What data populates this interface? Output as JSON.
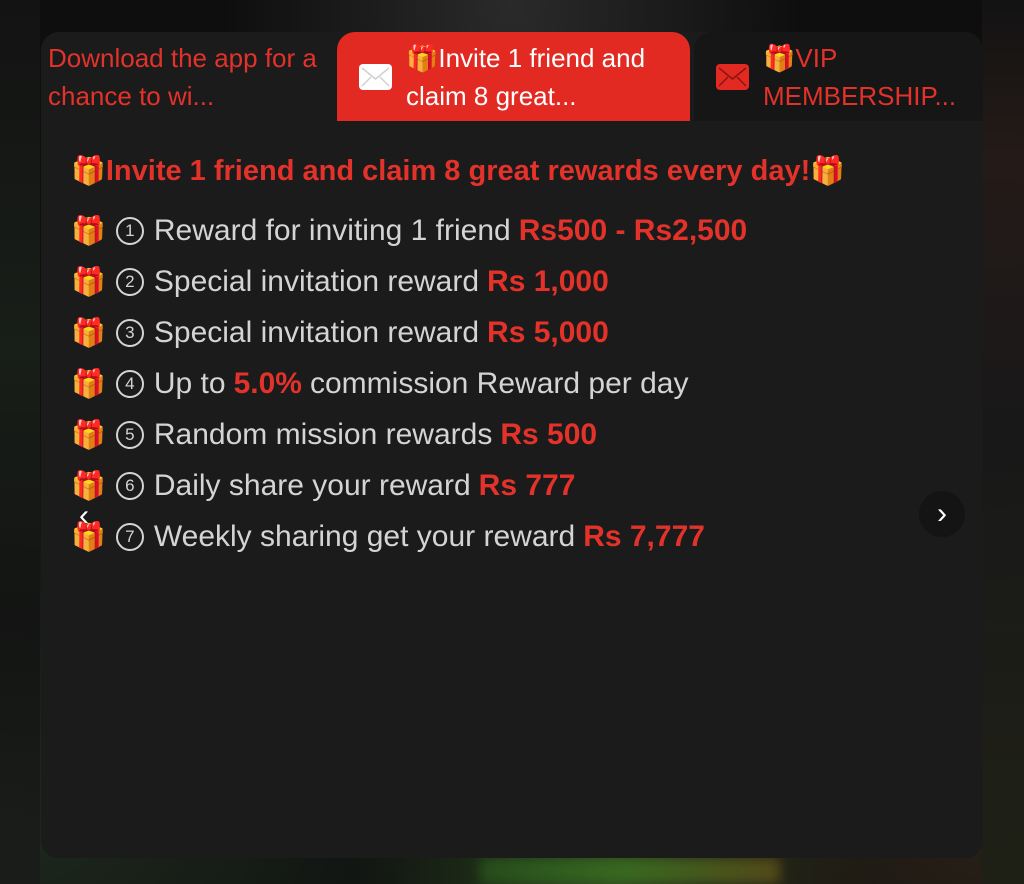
{
  "tabs": [
    {
      "label": "Download the app for a chance to wi...",
      "active": false,
      "icon": "none"
    },
    {
      "label": "🎁Invite 1 friend and claim 8 great...",
      "active": true,
      "icon": "mail-icon"
    },
    {
      "label": "🎁VIP MEMBERSHIP...",
      "active": false,
      "icon": "mail-icon"
    }
  ],
  "headline": {
    "gift_left": "🎁",
    "text": "Invite 1 friend and claim 8 great rewards every day!",
    "gift_right": "🎁"
  },
  "rewards": [
    {
      "gift": "🎁",
      "num": "1",
      "text": "Reward for inviting 1 friend",
      "amount": "Rs500 - Rs2,500"
    },
    {
      "gift": "🎁",
      "num": "2",
      "text": "Special invitation reward",
      "amount": "Rs 1,000"
    },
    {
      "gift": "🎁",
      "num": "3",
      "text": "Special invitation reward",
      "amount": "Rs 5,000"
    },
    {
      "gift": "🎁",
      "num": "4",
      "text_before": "Up to",
      "amount": "5.0%",
      "text_after": "commission Reward per day"
    },
    {
      "gift": "🎁",
      "num": "5",
      "text": "Random mission rewards",
      "amount": "Rs 500"
    },
    {
      "gift": "🎁",
      "num": "6",
      "text": "Daily share your reward",
      "amount": "Rs 777"
    },
    {
      "gift": "🎁",
      "num": "7",
      "text": "Weekly sharing get your reward",
      "amount": "Rs 7,777"
    }
  ],
  "nav": {
    "prev": "‹",
    "next": "›"
  },
  "colors": {
    "accent": "#e2322a",
    "panel": "#1b1b1b",
    "text": "#d4d4d4"
  }
}
